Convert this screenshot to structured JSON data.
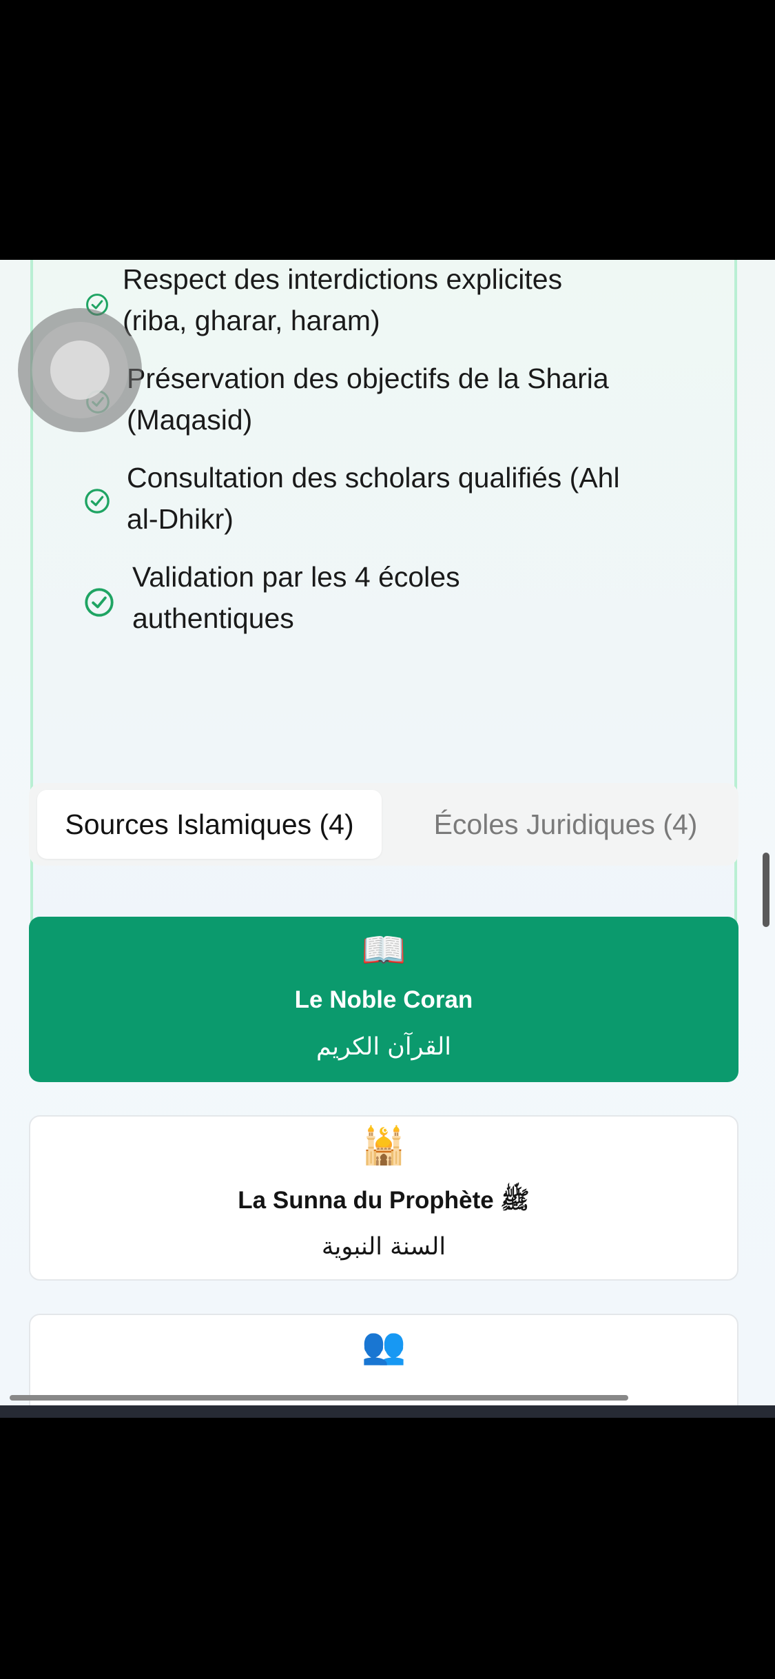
{
  "principles": [
    {
      "line1": "Respect des interdictions explicites",
      "line2": "(riba, gharar, haram)"
    },
    {
      "line1": "Préservation des objectifs de la Sharia",
      "line2": "(Maqasid)"
    },
    {
      "line1": "Consultation des scholars qualifiés (Ahl",
      "line2": "al-Dhikr)"
    },
    {
      "line1": "Validation par les 4 écoles",
      "line2": "authentiques"
    }
  ],
  "tabs": {
    "sources_label": "Sources Islamiques (4)",
    "schools_label": "Écoles Juridiques (4)"
  },
  "sources": [
    {
      "icon": "📖",
      "title": "Le Noble Coran",
      "arabic": "القرآن الكريم"
    },
    {
      "icon": "🕌",
      "title": "La Sunna du Prophète ﷺ",
      "arabic": "السنة النبوية"
    },
    {
      "icon": "👥"
    }
  ],
  "colors": {
    "accent_green": "#0b9a6d",
    "check_green": "#1fa463",
    "card_border": "#b9efd3"
  },
  "icons": {
    "check": "check-circle-icon",
    "quran": "open-book-icon",
    "sunna": "mosque-icon",
    "consensus": "people-icon"
  }
}
